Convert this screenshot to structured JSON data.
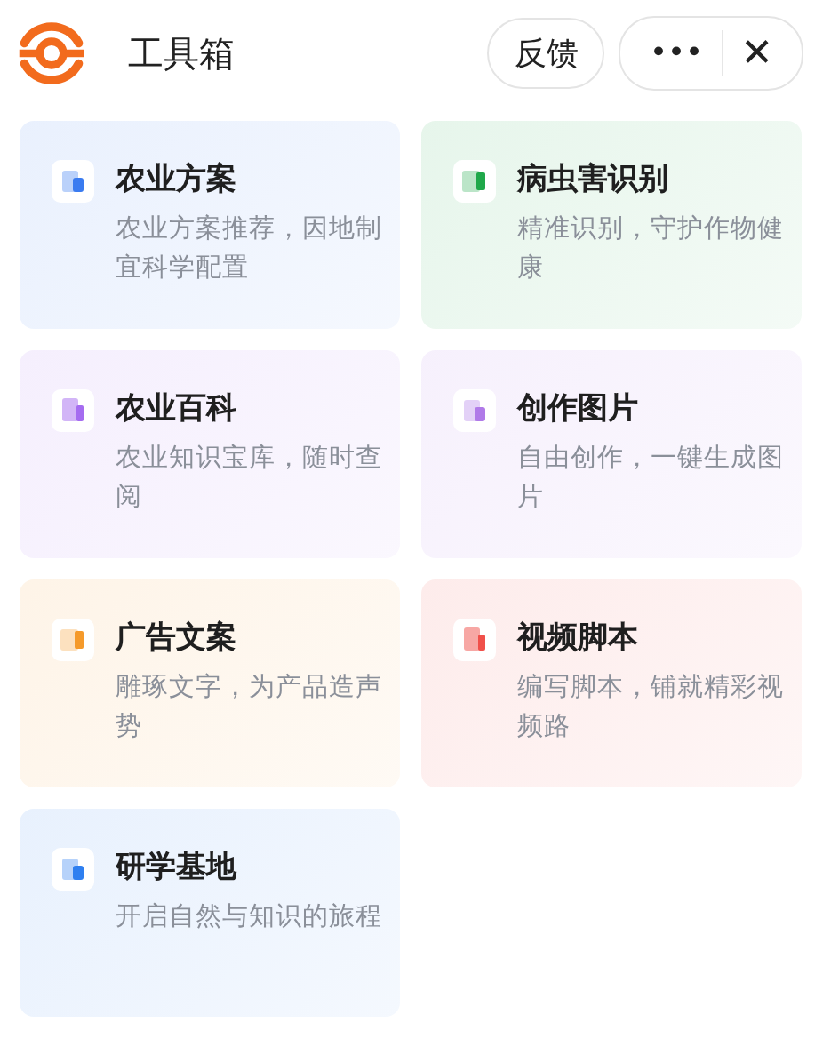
{
  "header": {
    "title": "工具箱",
    "feedback_button": "反馈",
    "more_button": "•••",
    "close_button": "✕"
  },
  "tools": [
    {
      "title": "农业方案",
      "description": "农业方案推荐，因地制宜科学配置",
      "color": "#3a7bf0"
    },
    {
      "title": "病虫害识别",
      "description": "精准识别，守护作物健康",
      "color": "#1fa84a"
    },
    {
      "title": "农业百科",
      "description": "农业知识宝库，随时查阅",
      "color": "#a56cf0"
    },
    {
      "title": "创作图片",
      "description": "自由创作，一键生成图片",
      "color": "#b07ae8"
    },
    {
      "title": "广告文案",
      "description": "雕琢文字，为产品造声势",
      "color": "#f59a2a"
    },
    {
      "title": "视频脚本",
      "description": "编写脚本，铺就精彩视频路",
      "color": "#f0504a"
    },
    {
      "title": "研学基地",
      "description": "开启自然与知识的旅程",
      "color": "#2e7ff0"
    }
  ]
}
